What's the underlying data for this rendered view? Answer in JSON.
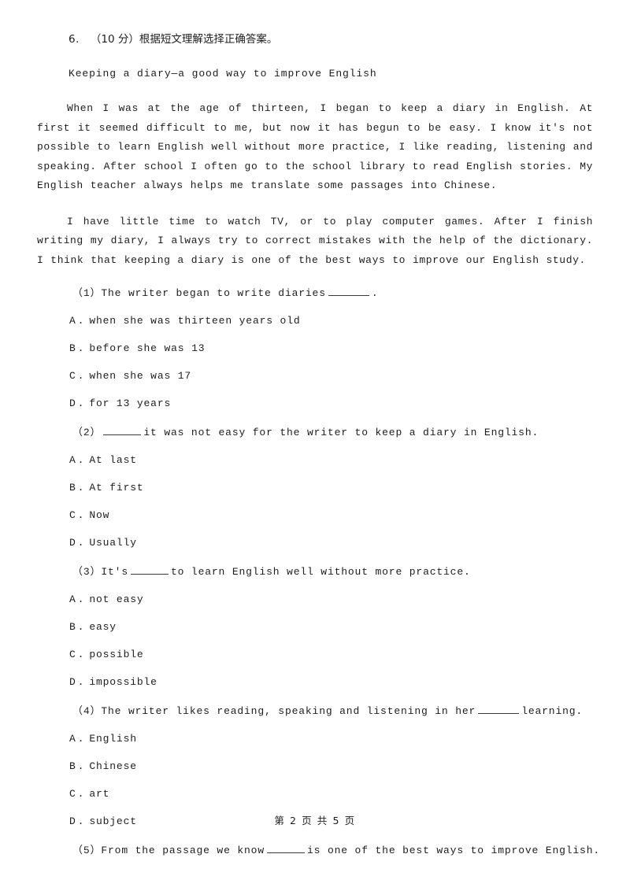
{
  "document": {
    "instruction_number": "6.",
    "instruction_text": "（10 分）根据短文理解选择正确答案。",
    "passage_title": "Keeping a diary—a good way to improve English",
    "paragraphs": [
      "When I was at the age of thirteen, I began to keep a diary in English. At first it seemed difficult to me, but now it has begun to be easy. I know it's not possible to learn English well without more practice, I like reading, listening and speaking. After school I often go to the school library to read English stories. My English teacher always helps me translate some passages into Chinese.",
      "I have little time to watch TV, or to play computer games. After I finish writing my diary, I always try to correct mistakes with the help of the dictionary. I think that keeping a diary is one of the best ways to improve our English study."
    ],
    "questions": [
      {
        "number": "（1）",
        "stem_before": "The writer began to write diaries",
        "stem_after": ".",
        "options": [
          {
            "letter": "A",
            "dot": ".",
            "text": "when she was thirteen years old"
          },
          {
            "letter": "B",
            "dot": ".",
            "text": "before she was 13"
          },
          {
            "letter": "C",
            "dot": ".",
            "text": "when she was 17"
          },
          {
            "letter": "D",
            "dot": ".",
            "text": "for 13 years"
          }
        ]
      },
      {
        "number": "（2）",
        "stem_before": "",
        "stem_after": "it was not easy for the writer to keep a diary in English.",
        "options": [
          {
            "letter": "A",
            "dot": ".",
            "text": "At last"
          },
          {
            "letter": "B",
            "dot": ".",
            "text": "At first"
          },
          {
            "letter": "C",
            "dot": ".",
            "text": "Now"
          },
          {
            "letter": "D",
            "dot": ".",
            "text": "Usually"
          }
        ]
      },
      {
        "number": "（3）",
        "stem_before": "It's",
        "stem_after": "to learn English well without more practice.",
        "options": [
          {
            "letter": "A",
            "dot": ".",
            "text": "not easy"
          },
          {
            "letter": "B",
            "dot": ".",
            "text": "easy"
          },
          {
            "letter": "C",
            "dot": ".",
            "text": "possible"
          },
          {
            "letter": "D",
            "dot": ".",
            "text": "impossible"
          }
        ]
      },
      {
        "number": "（4）",
        "stem_before": "The writer likes reading, speaking and listening in her",
        "stem_after": "learning.",
        "options": [
          {
            "letter": "A",
            "dot": ".",
            "text": "English"
          },
          {
            "letter": "B",
            "dot": ".",
            "text": "Chinese"
          },
          {
            "letter": "C",
            "dot": ".",
            "text": "art"
          },
          {
            "letter": "D",
            "dot": ".",
            "text": "subject"
          }
        ]
      },
      {
        "number": "（5）",
        "stem_before": "From the passage we know",
        "stem_after": "is one of the best ways to improve English.",
        "options": []
      }
    ],
    "footer": "第 2 页 共 5 页"
  }
}
